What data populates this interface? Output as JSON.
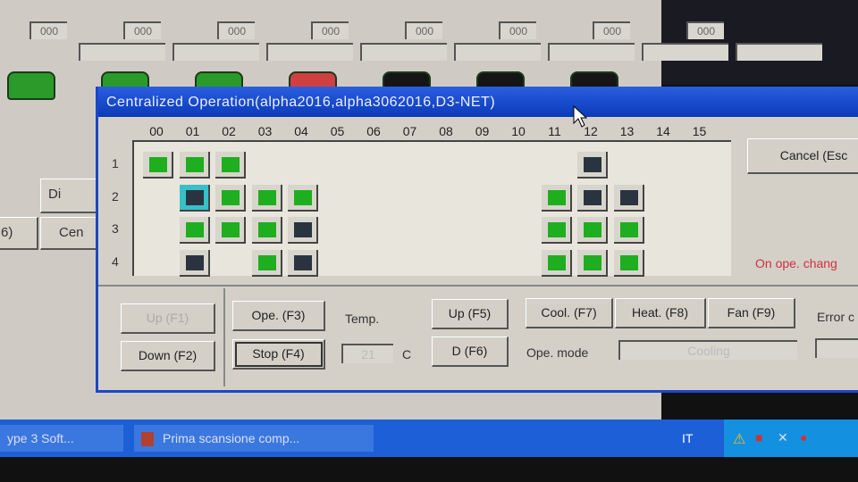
{
  "background_app": {
    "counter_fields": [
      "000",
      "000",
      "000",
      "000",
      "000",
      "000",
      "000",
      "000"
    ],
    "partial_buttons": [
      "Di",
      "Cen",
      "6)"
    ],
    "unit_icon_colors": [
      "#2a9a2a",
      "#2a9a2a",
      "#2a9a2a",
      "#d04040",
      "#151515",
      "#151515",
      "#151515"
    ]
  },
  "dialog": {
    "title": "Centralized Operation(alpha2016,alpha3062016,D3-NET)",
    "columns": [
      "00",
      "01",
      "02",
      "03",
      "04",
      "05",
      "06",
      "07",
      "08",
      "09",
      "10",
      "11",
      "12",
      "13",
      "14",
      "15"
    ],
    "rows": [
      "1",
      "2",
      "3",
      "4"
    ],
    "cells": [
      {
        "row": 1,
        "col": 0,
        "status": "on"
      },
      {
        "row": 1,
        "col": 1,
        "status": "on"
      },
      {
        "row": 1,
        "col": 2,
        "status": "on"
      },
      {
        "row": 1,
        "col": 12,
        "status": "off"
      },
      {
        "row": 2,
        "col": 1,
        "status": "off",
        "selected": true
      },
      {
        "row": 2,
        "col": 2,
        "status": "on"
      },
      {
        "row": 2,
        "col": 3,
        "status": "on"
      },
      {
        "row": 2,
        "col": 4,
        "status": "on"
      },
      {
        "row": 2,
        "col": 11,
        "status": "on"
      },
      {
        "row": 2,
        "col": 12,
        "status": "off"
      },
      {
        "row": 2,
        "col": 13,
        "status": "off"
      },
      {
        "row": 3,
        "col": 1,
        "status": "on"
      },
      {
        "row": 3,
        "col": 2,
        "status": "on"
      },
      {
        "row": 3,
        "col": 3,
        "status": "on"
      },
      {
        "row": 3,
        "col": 4,
        "status": "off"
      },
      {
        "row": 3,
        "col": 11,
        "status": "on"
      },
      {
        "row": 3,
        "col": 12,
        "status": "on"
      },
      {
        "row": 3,
        "col": 13,
        "status": "on"
      },
      {
        "row": 4,
        "col": 1,
        "status": "off"
      },
      {
        "row": 4,
        "col": 3,
        "status": "on"
      },
      {
        "row": 4,
        "col": 4,
        "status": "off"
      },
      {
        "row": 4,
        "col": 11,
        "status": "on"
      },
      {
        "row": 4,
        "col": 12,
        "status": "on"
      },
      {
        "row": 4,
        "col": 13,
        "status": "on"
      }
    ],
    "status_colors": {
      "on": "#1fae1f",
      "off": "#2a3440"
    },
    "cancel_label": "Cancel (Esc",
    "message": "On ope. chang",
    "up_f1": "Up (F1)",
    "down_f2": "Down (F2)",
    "ope_f3": "Ope. (F3)",
    "stop_f4": "Stop (F4)",
    "temp_label": "Temp.",
    "temp_value": "21",
    "temp_unit": "C",
    "up_f5": "Up (F5)",
    "d_f6": "D (F6)",
    "cool_f7": "Cool. (F7)",
    "heat_f8": "Heat. (F8)",
    "fan_f9": "Fan (F9)",
    "ope_mode_label": "Ope. mode",
    "ope_mode_value": "Cooling",
    "error_label": "Error c"
  },
  "taskbar": {
    "item1": "ype 3 Soft...",
    "item2": "Prima scansione comp...",
    "language": "IT"
  }
}
